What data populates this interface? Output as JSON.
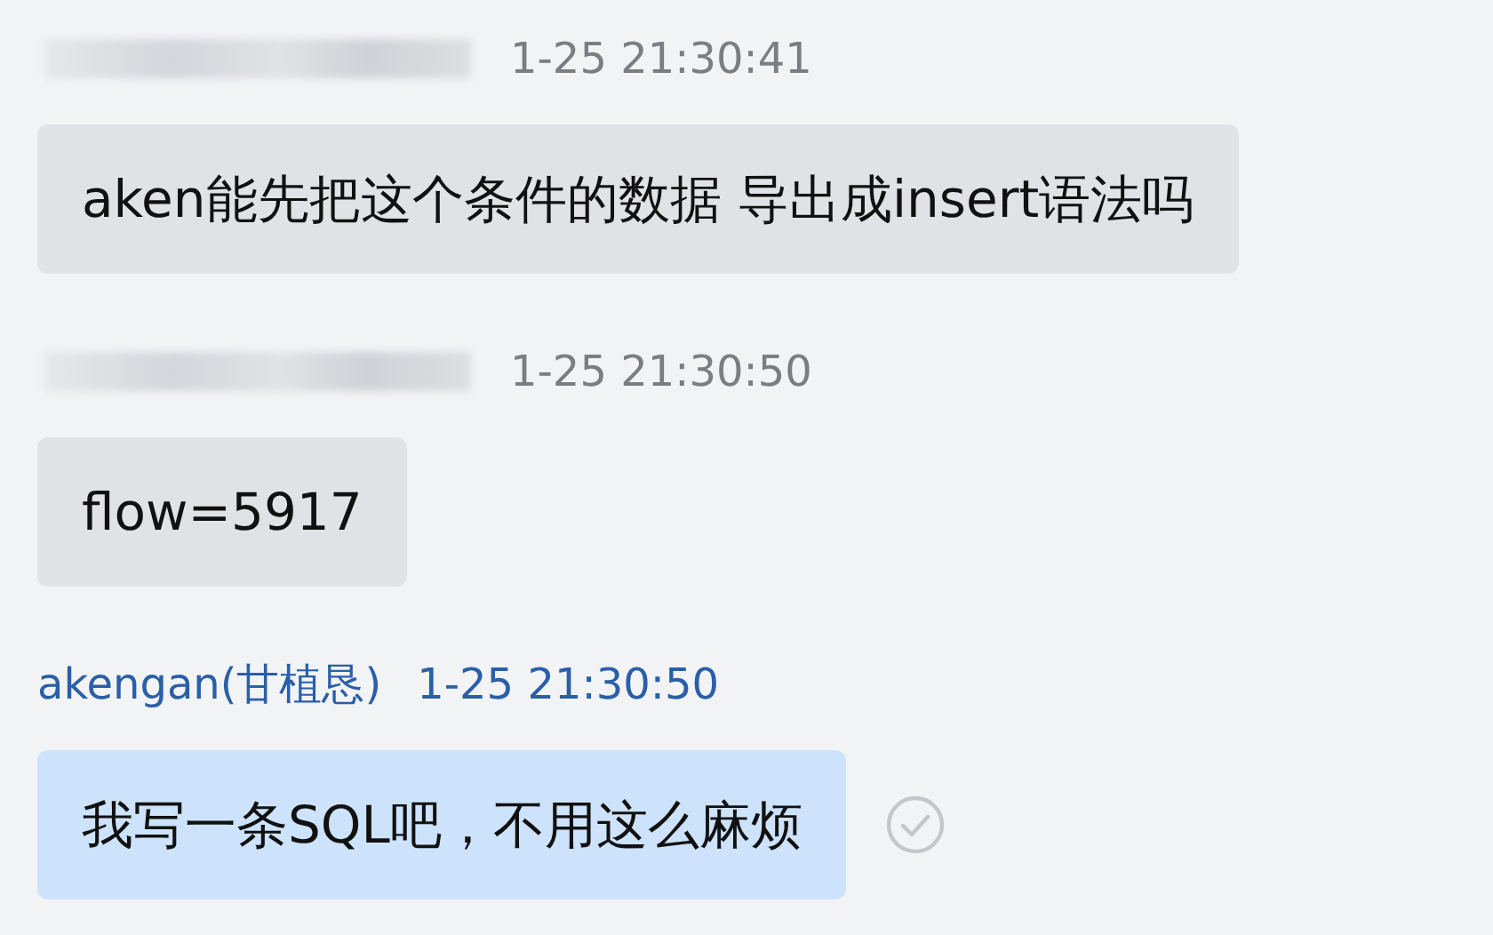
{
  "messages": [
    {
      "kind": "incoming",
      "time": "1-25 21:30:41",
      "text": "aken能先把这个条件的数据 导出成insert语法吗"
    },
    {
      "kind": "incoming",
      "time": "1-25 21:30:50",
      "text": "flow=5917"
    },
    {
      "kind": "outgoing",
      "sender": "akengan(甘植恳)",
      "time": "1-25 21:30:50",
      "text": "我写一条SQL吧，不用这么麻烦",
      "read": true
    }
  ]
}
